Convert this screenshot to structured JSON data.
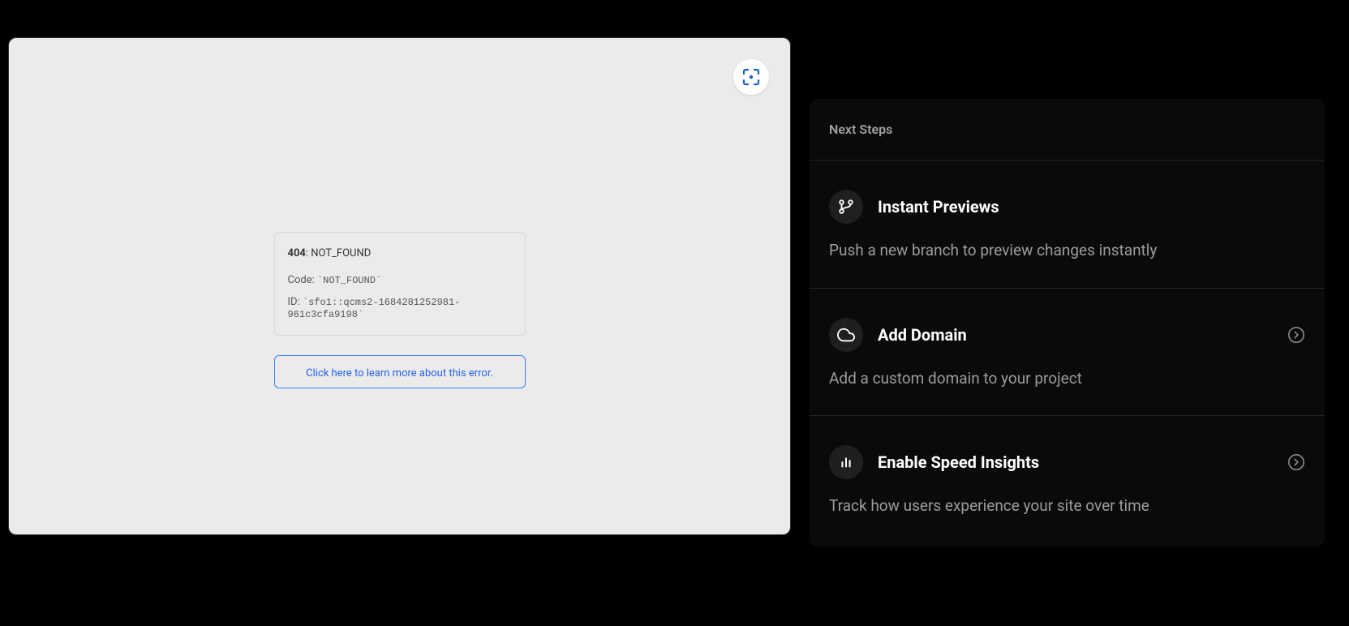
{
  "preview": {
    "error": {
      "code_bold": "404",
      "code_suffix": ": NOT_FOUND",
      "code_label": "Code: ",
      "code_value": "`NOT_FOUND`",
      "id_label": "ID: ",
      "id_value": "`sfo1::qcms2-1684281252981-961c3cfa9198`"
    },
    "learn_more": "Click here to learn more about this error."
  },
  "sidebar": {
    "title": "Next Steps",
    "steps": [
      {
        "title": "Instant Previews",
        "description": "Push a new branch to preview changes instantly",
        "has_arrow": false
      },
      {
        "title": "Add Domain",
        "description": "Add a custom domain to your project",
        "has_arrow": true
      },
      {
        "title": "Enable Speed Insights",
        "description": "Track how users experience your site over time",
        "has_arrow": true
      }
    ]
  }
}
